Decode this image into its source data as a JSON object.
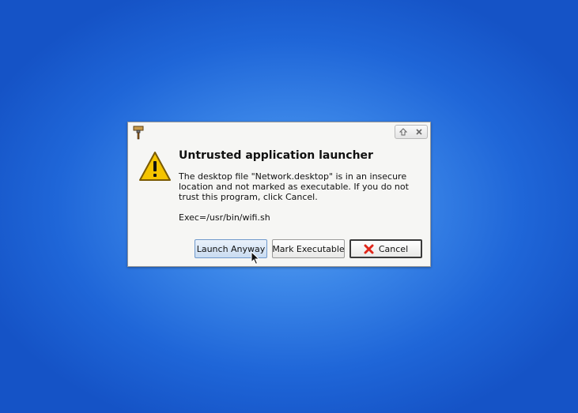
{
  "dialog": {
    "title": "Untrusted application launcher",
    "message": "The desktop file \"Network.desktop\" is in an insecure location and not marked as executable. If you do not trust this program, click Cancel.",
    "exec_line": "Exec=/usr/bin/wifi.sh",
    "buttons": {
      "launch_anyway": "Launch Anyway",
      "mark_executable": "Mark Executable",
      "cancel": "Cancel"
    },
    "icons": {
      "app": "paintbrush-icon",
      "warning": "warning-triangle-icon",
      "maximize": "maximize-icon",
      "close": "close-icon",
      "cancel": "cancel-x-icon"
    }
  },
  "colors": {
    "desktop_blue": "#1f66d8",
    "warning_yellow": "#f5c400",
    "cancel_red": "#e0271b"
  }
}
